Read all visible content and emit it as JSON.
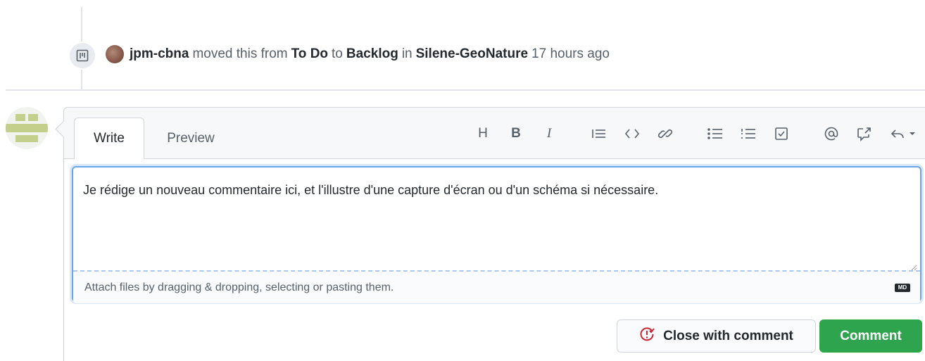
{
  "event": {
    "actor": "jpm-cbna",
    "text_moved": "moved this from",
    "from_column": "To Do",
    "text_to": "to",
    "to_column": "Backlog",
    "text_in": "in",
    "project": "Silene-GeoNature",
    "time": "17 hours ago",
    "badge_icon": "project-icon"
  },
  "comment_form": {
    "tabs": [
      "Write",
      "Preview"
    ],
    "active_tab": "Write",
    "toolbar": {
      "heading": "H",
      "bold": "B",
      "italic": "I",
      "icons": [
        "heading-icon",
        "bold-icon",
        "italic-icon",
        "quote-icon",
        "code-icon",
        "link-icon",
        "bulleted-list-icon",
        "numbered-list-icon",
        "task-list-icon",
        "mention-icon",
        "cross-reference-icon",
        "reply-icon"
      ]
    },
    "body_value": "Je rédige un nouveau commentaire ici, et l'illustre d'une capture d'écran ou d'un schéma si nécessaire.",
    "attach_hint": "Attach files by dragging & dropping, selecting or pasting them.",
    "markdown_badge": "MD"
  },
  "actions": {
    "close_label": "Close with comment",
    "comment_label": "Comment"
  },
  "colors": {
    "accent_green": "#2ea44f",
    "focus_blue": "#6aa5e8",
    "close_icon_red": "#cb2431"
  }
}
